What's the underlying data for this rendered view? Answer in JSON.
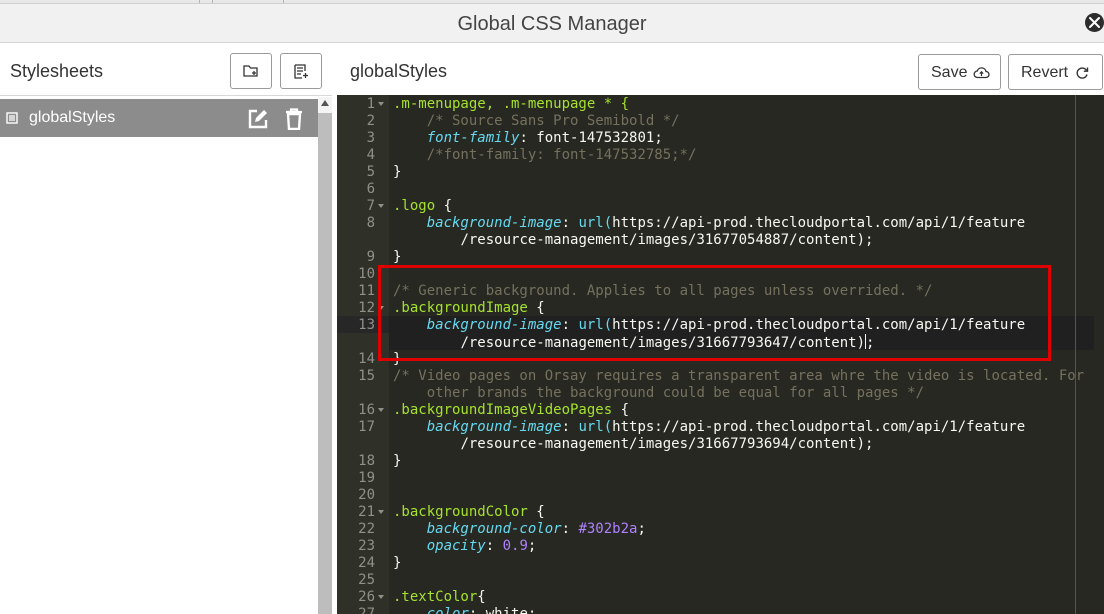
{
  "window": {
    "title": "Global CSS Manager"
  },
  "left_panel": {
    "title": "Stylesheets",
    "items": [
      {
        "label": "globalStyles"
      }
    ]
  },
  "right_panel": {
    "title": "globalStyles",
    "save_label": "Save",
    "revert_label": "Revert"
  },
  "editor": {
    "line_numbers": [
      "1",
      "2",
      "3",
      "4",
      "5",
      "6",
      "7",
      "8",
      "",
      "9",
      "10",
      "11",
      "12",
      "13",
      "",
      "14",
      "15",
      "",
      "16",
      "17",
      "",
      "18",
      "19",
      "20",
      "21",
      "22",
      "23",
      "24",
      "25",
      "26",
      "27"
    ],
    "code": {
      "l1_sel": ".m-menupage, .m-menupage * {",
      "l2_cmt": "/* Source Sans Pro Semibold */",
      "l3_prop": "font-family",
      "l3_val": "font-147532801",
      "l4_cmt": "/*font-family: font-147532785;*/",
      "l5": "}",
      "l7_sel": ".logo",
      "l8_prop": "background-image",
      "l8_fn": "url(",
      "l8_url_a": "https://api-prod.thecloudportal.com/api/1/feature",
      "l8_url_b": "/resource-management/images/31677054887/content",
      "l9": "}",
      "l11_cmt": "/* Generic background. Applies to all pages unless overrided. */",
      "l12_sel": ".backgroundImage",
      "l13_prop": "background-image",
      "l13_fn": "url(",
      "l13_url_a": "https://api-prod.thecloudportal.com/api/1/feature",
      "l13_url_b": "/resource-management/images/31667793647/content",
      "l14": "}",
      "l15_cmt_a": "/* Video pages on Orsay requires a transparent area whre the video is located. For",
      "l15_cmt_b": "other brands the background could be equal for all pages */",
      "l16_sel": ".backgroundImageVideoPages",
      "l17_prop": "background-image",
      "l17_fn": "url(",
      "l17_url_a": "https://api-prod.thecloudportal.com/api/1/feature",
      "l17_url_b": "/resource-management/images/31667793694/content",
      "l18": "}",
      "l21_sel": ".backgroundColor",
      "l22_prop": "background-color",
      "l22_val": "#302b2a",
      "l23_prop": "opacity",
      "l23_val": "0.9",
      "l24": "}",
      "l26_sel": ".textColor",
      "l27_prop": "color",
      "l27_val": "white"
    }
  },
  "colors": {
    "editor_bg": "#272822",
    "selector": "#a6e22e",
    "comment": "#75715e",
    "property": "#66d9ef",
    "number": "#ae81ff",
    "highlight_box": "#e00000",
    "list_selected": "#8c8c8c"
  },
  "icons": {
    "close": "close-icon",
    "new_folder": "new-folder-icon",
    "new_file": "new-file-icon",
    "file": "file-icon",
    "edit": "edit-icon",
    "trash": "trash-icon",
    "cloud_upload": "cloud-upload-icon",
    "refresh": "refresh-icon"
  }
}
